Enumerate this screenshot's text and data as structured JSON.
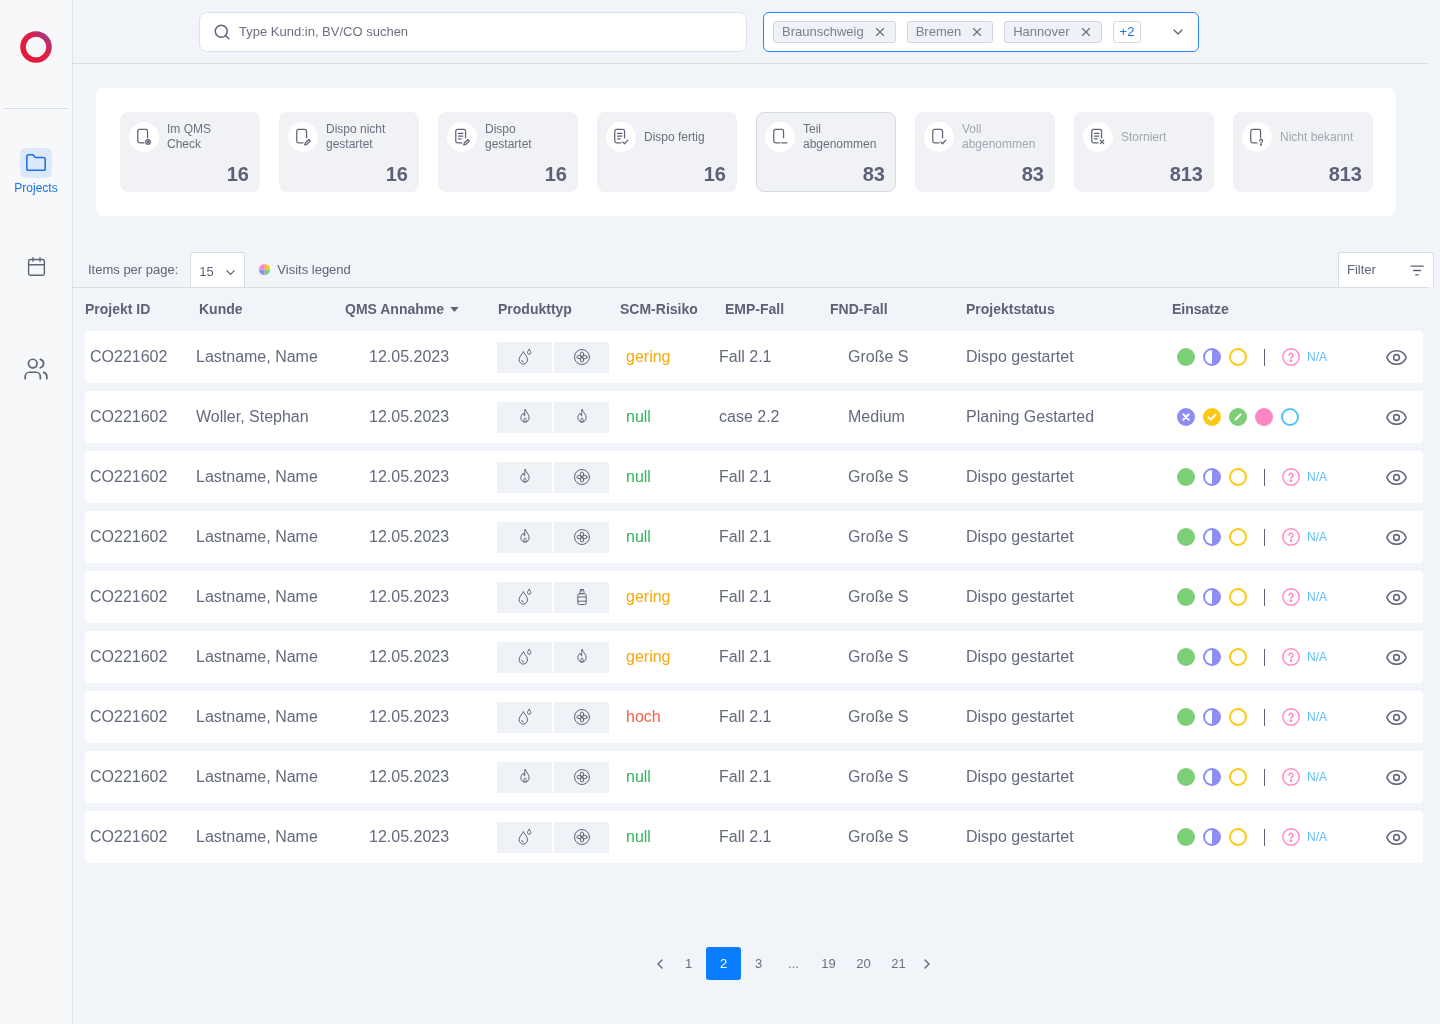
{
  "sidebar": {
    "items": [
      {
        "kind": "folder",
        "label": "Projects",
        "selected": true
      },
      {
        "kind": "calendar",
        "selected": false
      },
      {
        "kind": "users",
        "selected": false
      }
    ]
  },
  "search": {
    "placeholder": "Type Kund:in, BV/CO suchen"
  },
  "location_filter": {
    "focused": true,
    "chips": [
      "Braunschweig",
      "Bremen",
      "Hannover"
    ],
    "more": "+2"
  },
  "status_cards": [
    {
      "kind": "review",
      "label": "Im QMS Check",
      "count": "16",
      "selected": false,
      "dimmed": false
    },
    {
      "kind": "draft",
      "label": "Dispo nicht gestartet",
      "count": "16",
      "selected": false,
      "dimmed": false
    },
    {
      "kind": "editing",
      "label": "Dispo gestartet",
      "count": "16",
      "selected": false,
      "dimmed": false
    },
    {
      "kind": "done",
      "label": "Dispo fertig",
      "count": "16",
      "selected": false,
      "dimmed": false
    },
    {
      "kind": "partial",
      "label": "Teil abgenommen",
      "count": "83",
      "selected": true,
      "dimmed": false
    },
    {
      "kind": "accepted",
      "label": "Voll abgenommen",
      "count": "83",
      "selected": false,
      "dimmed": true
    },
    {
      "kind": "cancelled",
      "label": "Storniert",
      "count": "813",
      "selected": false,
      "dimmed": true
    },
    {
      "kind": "unknown",
      "label": "Nicht bekannt",
      "count": "813",
      "selected": false,
      "dimmed": true
    }
  ],
  "table_toolbar": {
    "items_per_page_label": "Items per page:",
    "items_per_page": "15",
    "legend_label": "Visits legend",
    "filter_label": "Filter"
  },
  "table": {
    "columns": [
      {
        "label": "Projekt ID",
        "sorted": false
      },
      {
        "label": "Kunde",
        "sorted": false
      },
      {
        "label": "QMS Annahme",
        "sorted": true
      },
      {
        "label": "Produkttyp",
        "sorted": false
      },
      {
        "label": "SCM-Risiko",
        "sorted": false
      },
      {
        "label": "EMP-Fall",
        "sorted": false
      },
      {
        "label": "FND-Fall",
        "sorted": false
      },
      {
        "label": "Projektstatus",
        "sorted": false
      },
      {
        "label": "Einsatze",
        "sorted": false
      }
    ],
    "rows": [
      {
        "id": "CO221602",
        "customer": "Lastname, Name",
        "date": "12.05.2023",
        "products": [
          {
            "kind": "drops"
          },
          {
            "kind": "fan"
          }
        ],
        "risk": {
          "text": "gering",
          "color": "#f7a80d"
        },
        "emp": "Fall 2.1",
        "fnd": "Große S",
        "status": "Dispo gestartet",
        "visits": [
          {
            "kind": "filled",
            "color": "#7ccf77"
          },
          {
            "kind": "half",
            "color": "#8c8df5"
          },
          {
            "kind": "ring",
            "color": "#fcc812"
          }
        ],
        "unknown": "N/A"
      },
      {
        "id": "CO221602",
        "customer": "Woller, Stephan",
        "date": "12.05.2023",
        "products": [
          {
            "kind": "flame"
          },
          {
            "kind": "flame"
          }
        ],
        "risk": {
          "text": "null",
          "color": "#34b35a"
        },
        "emp": "case 2.2",
        "fnd": "Medium",
        "status": "Planing Gestarted",
        "visits": [
          {
            "kind": "cross",
            "color": "#8c8df5"
          },
          {
            "kind": "check",
            "color": "#fcc812"
          },
          {
            "kind": "slash",
            "color": "#7ccf77"
          },
          {
            "kind": "filled",
            "color": "#ff86c6"
          },
          {
            "kind": "ring",
            "color": "#4dc4fb"
          }
        ]
      },
      {
        "id": "CO221602",
        "customer": "Lastname, Name",
        "date": "12.05.2023",
        "products": [
          {
            "kind": "flame"
          },
          {
            "kind": "fan"
          }
        ],
        "risk": {
          "text": "null",
          "color": "#34b35a"
        },
        "emp": "Fall 2.1",
        "fnd": "Große S",
        "status": "Dispo gestartet",
        "visits": [
          {
            "kind": "filled",
            "color": "#7ccf77"
          },
          {
            "kind": "half",
            "color": "#8c8df5"
          },
          {
            "kind": "ring",
            "color": "#fcc812"
          }
        ],
        "unknown": "N/A"
      },
      {
        "id": "CO221602",
        "customer": "Lastname, Name",
        "date": "12.05.2023",
        "products": [
          {
            "kind": "flame"
          },
          {
            "kind": "fan"
          }
        ],
        "risk": {
          "text": "null",
          "color": "#34b35a"
        },
        "emp": "Fall 2.1",
        "fnd": "Große S",
        "status": "Dispo gestartet",
        "visits": [
          {
            "kind": "filled",
            "color": "#7ccf77"
          },
          {
            "kind": "half",
            "color": "#8c8df5"
          },
          {
            "kind": "ring",
            "color": "#fcc812"
          }
        ],
        "unknown": "N/A"
      },
      {
        "id": "CO221602",
        "customer": "Lastname, Name",
        "date": "12.05.2023",
        "products": [
          {
            "kind": "drops"
          },
          {
            "kind": "cylinder"
          }
        ],
        "risk": {
          "text": "gering",
          "color": "#f7a80d"
        },
        "emp": "Fall 2.1",
        "fnd": "Große S",
        "status": "Dispo gestartet",
        "visits": [
          {
            "kind": "filled",
            "color": "#7ccf77"
          },
          {
            "kind": "half",
            "color": "#8c8df5"
          },
          {
            "kind": "ring",
            "color": "#fcc812"
          }
        ],
        "unknown": "N/A"
      },
      {
        "id": "CO221602",
        "customer": "Lastname, Name",
        "date": "12.05.2023",
        "products": [
          {
            "kind": "drops"
          },
          {
            "kind": "flame"
          }
        ],
        "risk": {
          "text": "gering",
          "color": "#f7a80d"
        },
        "emp": "Fall 2.1",
        "fnd": "Große S",
        "status": "Dispo gestartet",
        "visits": [
          {
            "kind": "filled",
            "color": "#7ccf77"
          },
          {
            "kind": "half",
            "color": "#8c8df5"
          },
          {
            "kind": "ring",
            "color": "#fcc812"
          }
        ],
        "unknown": "N/A"
      },
      {
        "id": "CO221602",
        "customer": "Lastname, Name",
        "date": "12.05.2023",
        "products": [
          {
            "kind": "drops"
          },
          {
            "kind": "fan"
          }
        ],
        "risk": {
          "text": "hoch",
          "color": "#f55d45"
        },
        "emp": "Fall 2.1",
        "fnd": "Große S",
        "status": "Dispo gestartet",
        "visits": [
          {
            "kind": "filled",
            "color": "#7ccf77"
          },
          {
            "kind": "half",
            "color": "#8c8df5"
          },
          {
            "kind": "ring",
            "color": "#fcc812"
          }
        ],
        "unknown": "N/A"
      },
      {
        "id": "CO221602",
        "customer": "Lastname, Name",
        "date": "12.05.2023",
        "products": [
          {
            "kind": "flame"
          },
          {
            "kind": "fan"
          }
        ],
        "risk": {
          "text": "null",
          "color": "#34b35a"
        },
        "emp": "Fall 2.1",
        "fnd": "Große S",
        "status": "Dispo gestartet",
        "visits": [
          {
            "kind": "filled",
            "color": "#7ccf77"
          },
          {
            "kind": "half",
            "color": "#8c8df5"
          },
          {
            "kind": "ring",
            "color": "#fcc812"
          }
        ],
        "unknown": "N/A"
      },
      {
        "id": "CO221602",
        "customer": "Lastname, Name",
        "date": "12.05.2023",
        "products": [
          {
            "kind": "drops"
          },
          {
            "kind": "fan"
          }
        ],
        "risk": {
          "text": "null",
          "color": "#34b35a"
        },
        "emp": "Fall 2.1",
        "fnd": "Große S",
        "status": "Dispo gestartet",
        "visits": [
          {
            "kind": "filled",
            "color": "#7ccf77"
          },
          {
            "kind": "half",
            "color": "#8c8df5"
          },
          {
            "kind": "ring",
            "color": "#fcc812"
          }
        ],
        "unknown": "N/A"
      }
    ]
  },
  "pagination": {
    "pages": [
      {
        "label": "1",
        "selected": false
      },
      {
        "label": "2",
        "selected": true
      },
      {
        "label": "3",
        "selected": false
      },
      {
        "label": "...",
        "selected": false
      },
      {
        "label": "19",
        "selected": false
      },
      {
        "label": "20",
        "selected": false
      },
      {
        "label": "21",
        "selected": false
      }
    ]
  }
}
